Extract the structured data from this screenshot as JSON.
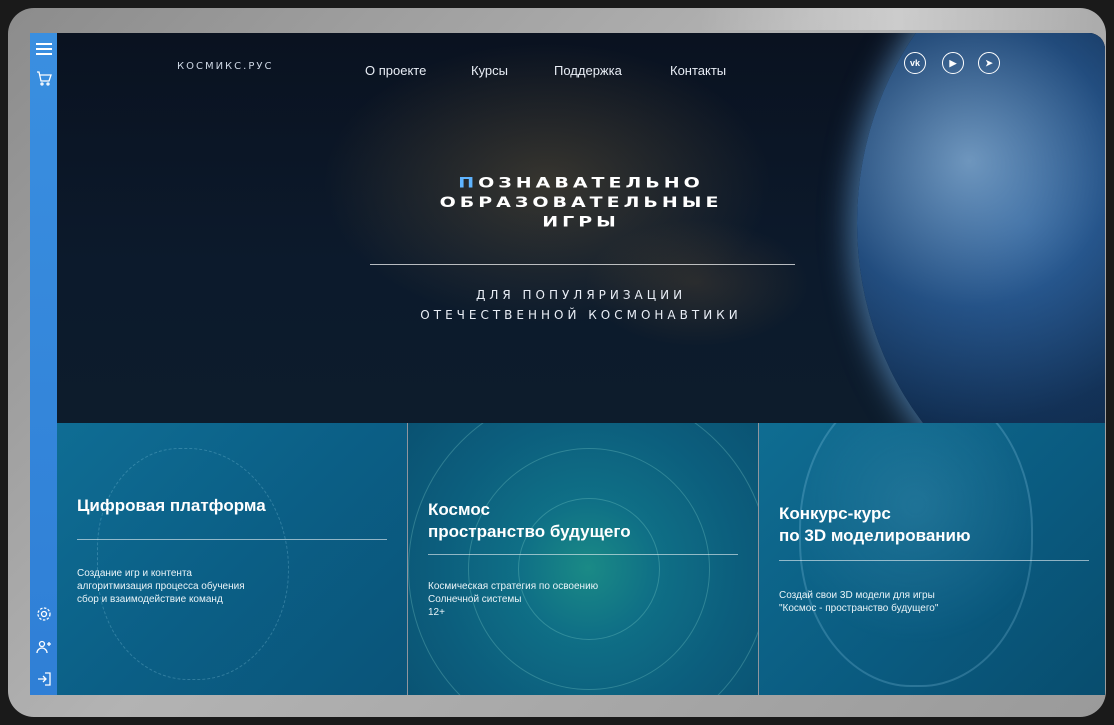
{
  "brand": {
    "logo": "КОСМИКС.РУС"
  },
  "nav": {
    "items": [
      "О проекте",
      "Курсы",
      "Поддержка",
      "Контакты"
    ]
  },
  "social": {
    "vk": "vk",
    "youtube": "▶",
    "telegram": "➤"
  },
  "sidebar": {
    "top_icons": [
      "menu-icon",
      "cart-icon"
    ],
    "bottom_icons": [
      "gear-icon",
      "add-user-icon",
      "login-icon"
    ]
  },
  "hero": {
    "title_accent": "П",
    "title_line1_rest": "ознавательно",
    "title_line2": "образовательные",
    "title_line3": "игры",
    "subtitle_line1": "для популяризации",
    "subtitle_line2": "отечественной космонавтики"
  },
  "cards": [
    {
      "title": "Цифровая платформа",
      "lines": [
        "Создание игр и контента",
        "алгоритмизация процесса обучения",
        "сбор и взаимодействие команд"
      ]
    },
    {
      "title_line1": "Космос",
      "title_line2": "пространство будущего",
      "lines": [
        "Космическая стратегия по освоению",
        "Солнечной системы",
        "12+"
      ]
    },
    {
      "title_line1": "Конкурс-курс",
      "title_line2": "по 3D моделированию",
      "lines": [
        "Создай свои 3D модели для игры",
        "\"Космос - пространство будущего\""
      ]
    }
  ],
  "colors": {
    "sidebar": "#3a8fe0",
    "accent": "#5fb4ff",
    "card": "#0b5f86"
  }
}
